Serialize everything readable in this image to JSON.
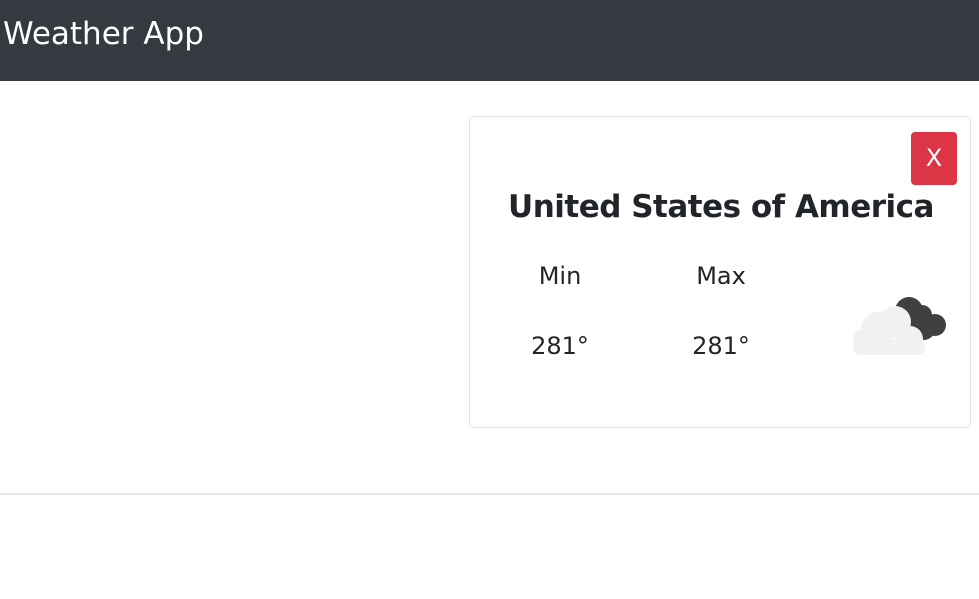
{
  "navbar": {
    "brand": "Weather App"
  },
  "card": {
    "close_label": "X",
    "country": "United States of America",
    "min_label": "Min",
    "max_label": "Max",
    "min_value": "281°",
    "max_value": "281°",
    "icon": "cloud-icon"
  },
  "colors": {
    "navbar_bg": "#343a40",
    "close_bg": "#dc3545"
  }
}
